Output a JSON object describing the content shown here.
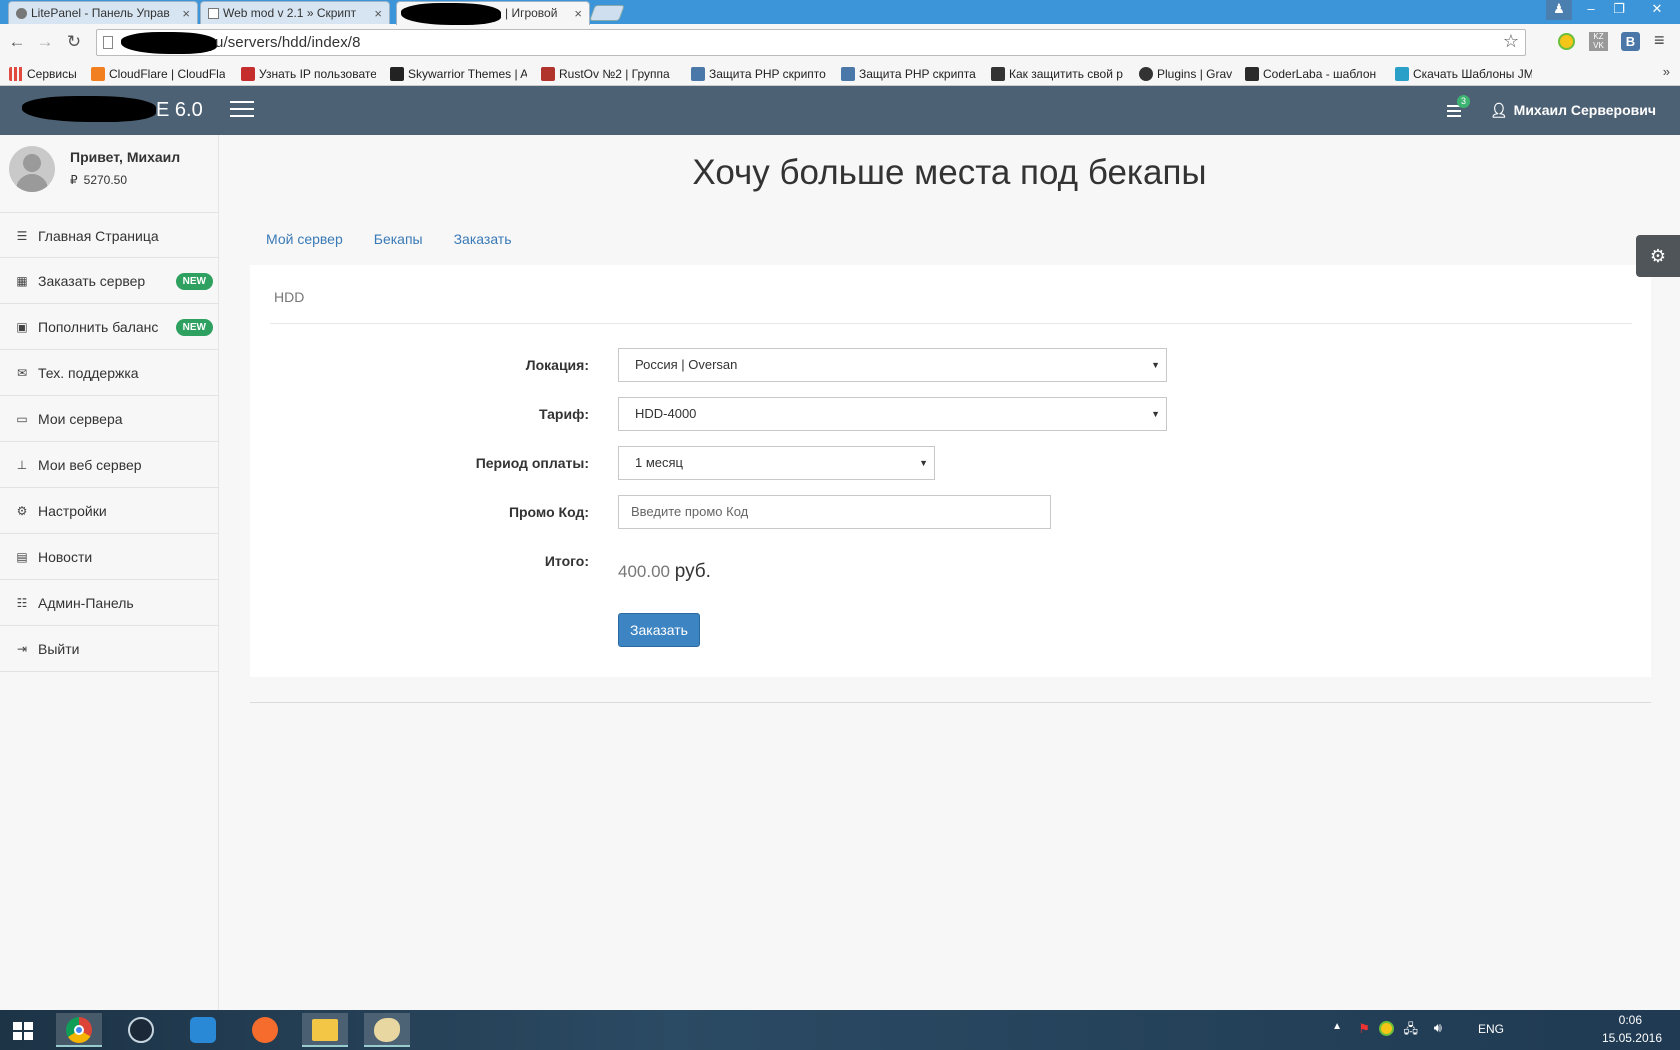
{
  "browser": {
    "tabs": [
      {
        "title": "LitePanel - Панель Управ"
      },
      {
        "title": "Web mod v 2.1 » Скрипт"
      },
      {
        "title": "| Игровой"
      }
    ],
    "url": "u/servers/hdd/index/8",
    "bookmarks": [
      {
        "label": "Сервисы",
        "color": "#e04a3f"
      },
      {
        "label": "CloudFlare | CloudFla",
        "color": "#f38020"
      },
      {
        "label": "Узнать IP пользовате",
        "color": "#c62d2d"
      },
      {
        "label": "Skywarrior Themes | A",
        "color": "#222222"
      },
      {
        "label": "RustOv №2 | Группа",
        "color": "#b0342b"
      },
      {
        "label": "Защита PHP скрипто",
        "color": "#4a78a8"
      },
      {
        "label": "Защита PHP скрипта",
        "color": "#4a78a8"
      },
      {
        "label": "Как защитить свой р",
        "color": "#333333"
      },
      {
        "label": "Plugins | Grav",
        "color": "#333333"
      },
      {
        "label": "CoderLaba - шаблон",
        "color": "#2b2b2b"
      },
      {
        "label": "Скачать Шаблоны JM",
        "color": "#2aa0c8"
      }
    ]
  },
  "header": {
    "brand": "E 6.0",
    "notifications_count": "3",
    "user_name": "Михаил Серверович"
  },
  "sidebar": {
    "greeting": "Привет, Михаил",
    "balance": "5270.50",
    "currency_icon": "₽",
    "items": [
      {
        "label": "Главная Страница",
        "icon": "list-icon"
      },
      {
        "label": "Заказать сервер",
        "icon": "grid-icon",
        "badge": "NEW"
      },
      {
        "label": "Пополнить баланс",
        "icon": "money-icon",
        "badge": "NEW"
      },
      {
        "label": "Тех. поддержка",
        "icon": "envelope-icon"
      },
      {
        "label": "Мои сервера",
        "icon": "laptop-icon"
      },
      {
        "label": "Мои веб сервер",
        "icon": "sitemap-icon"
      },
      {
        "label": "Настройки",
        "icon": "gears-icon"
      },
      {
        "label": "Новости",
        "icon": "calendar-icon"
      },
      {
        "label": "Админ-Панель",
        "icon": "list-alt-icon"
      },
      {
        "label": "Выйти",
        "icon": "sign-out-icon"
      }
    ]
  },
  "main": {
    "title": "Хочу больше места под бекапы",
    "tabs": [
      "Мой сервер",
      "Бекапы",
      "Заказать"
    ],
    "panel_title": "HDD",
    "form": {
      "location_label": "Локация:",
      "location_value": "Россия | Oversan",
      "tariff_label": "Тариф:",
      "tariff_value": "HDD-4000",
      "period_label": "Период оплаты:",
      "period_value": "1 месяц",
      "promo_label": "Промо Код:",
      "promo_placeholder": "Введите промо Код",
      "total_label": "Итого:",
      "total_value": "400.00",
      "total_currency": "руб.",
      "submit_label": "Заказать"
    }
  },
  "taskbar": {
    "lang": "ENG",
    "time": "0:06",
    "date": "15.05.2016"
  },
  "colors": {
    "header_bg": "#4d6174",
    "link": "#3a7ab7",
    "new_badge": "#2ea05f",
    "primary_button": "#3d84c2"
  }
}
